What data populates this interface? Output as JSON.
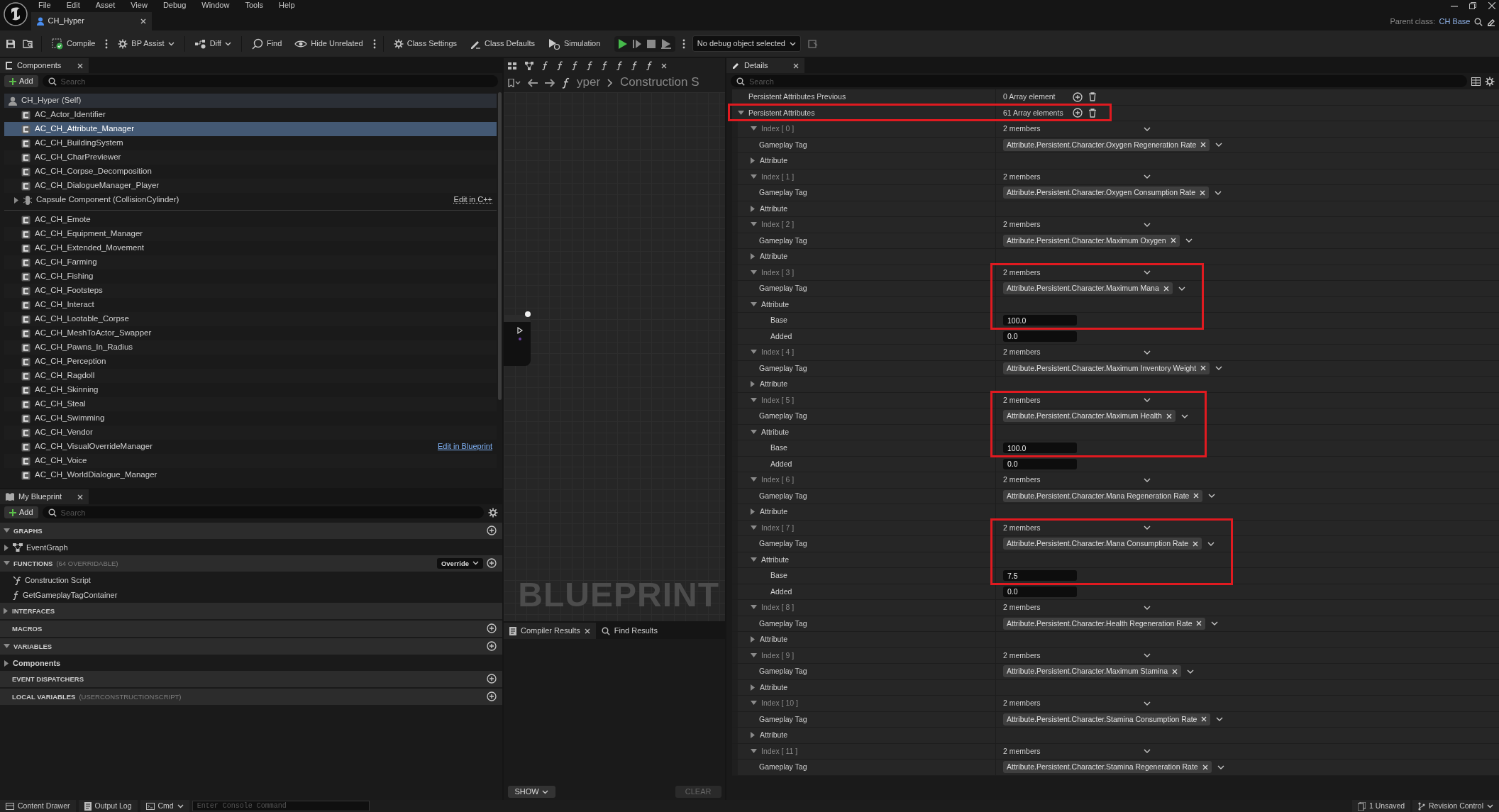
{
  "menu": [
    "File",
    "Edit",
    "Asset",
    "View",
    "Debug",
    "Window",
    "Tools",
    "Help"
  ],
  "document_tab": {
    "label": "CH_Hyper",
    "selected": true
  },
  "parent_class": {
    "label": "Parent class:",
    "value": "CH Base"
  },
  "toolbar": [
    {
      "label": "Compile",
      "more": true
    },
    {
      "label": "BP Assist",
      "dropdown": true
    },
    {
      "label": "Diff",
      "dropdown": true,
      "separator_before": true
    },
    {
      "label": "Find",
      "separator_before": true
    },
    {
      "label": "Hide Unrelated",
      "more": true
    },
    {
      "label": "Class Settings",
      "separator_before": true
    },
    {
      "label": "Class Defaults"
    },
    {
      "label": "Simulation"
    }
  ],
  "debug_object": "No debug object selected",
  "components": {
    "tab": "Components",
    "add_label": "Add",
    "search_placeholder": "Search",
    "root": "CH_Hyper (Self)",
    "items": [
      {
        "kind": "component",
        "label": "AC_Actor_Identifier",
        "selected": false
      },
      {
        "kind": "component",
        "label": "AC_CH_Attribute_Manager",
        "selected": true
      },
      {
        "kind": "component",
        "label": "AC_CH_BuildingSystem",
        "selected": false
      },
      {
        "kind": "component",
        "label": "AC_CH_CharPreviewer",
        "selected": false
      },
      {
        "kind": "component",
        "label": "AC_CH_Corpse_Decomposition",
        "selected": false
      },
      {
        "kind": "component",
        "label": "AC_CH_DialogueManager_Player",
        "selected": false
      },
      {
        "kind": "scene",
        "label": "Capsule Component (CollisionCylinder)",
        "selected": false,
        "expanded": false,
        "link": {
          "text": "Edit in C++",
          "kind": "cpp"
        }
      },
      {
        "kind": "divider"
      },
      {
        "kind": "component",
        "label": "AC_CH_Emote",
        "selected": false
      },
      {
        "kind": "component",
        "label": "AC_CH_Equipment_Manager",
        "selected": false
      },
      {
        "kind": "component",
        "label": "AC_CH_Extended_Movement",
        "selected": false
      },
      {
        "kind": "component",
        "label": "AC_CH_Farming",
        "selected": false
      },
      {
        "kind": "component",
        "label": "AC_CH_Fishing",
        "selected": false
      },
      {
        "kind": "component",
        "label": "AC_CH_Footsteps",
        "selected": false
      },
      {
        "kind": "component",
        "label": "AC_CH_Interact",
        "selected": false
      },
      {
        "kind": "component",
        "label": "AC_CH_Lootable_Corpse",
        "selected": false
      },
      {
        "kind": "component",
        "label": "AC_CH_MeshToActor_Swapper",
        "selected": false
      },
      {
        "kind": "component",
        "label": "AC_CH_Pawns_In_Radius",
        "selected": false
      },
      {
        "kind": "component",
        "label": "AC_CH_Perception",
        "selected": false
      },
      {
        "kind": "component",
        "label": "AC_CH_Ragdoll",
        "selected": false
      },
      {
        "kind": "component",
        "label": "AC_CH_Skinning",
        "selected": false
      },
      {
        "kind": "component",
        "label": "AC_CH_Steal",
        "selected": false
      },
      {
        "kind": "component",
        "label": "AC_CH_Swimming",
        "selected": false
      },
      {
        "kind": "component",
        "label": "AC_CH_Vendor",
        "selected": false
      },
      {
        "kind": "component",
        "label": "AC_CH_VisualOverrideManager",
        "selected": false,
        "link": {
          "text": "Edit in Blueprint",
          "kind": "blueprint"
        }
      },
      {
        "kind": "component",
        "label": "AC_CH_Voice",
        "selected": false
      },
      {
        "kind": "component",
        "label": "AC_CH_WorldDialogue_Manager",
        "selected": false
      }
    ]
  },
  "my_blueprint": {
    "tab": "My Blueprint",
    "add_label": "Add",
    "search_placeholder": "Search",
    "sections": [
      {
        "title": "GRAPHS",
        "expanded": true,
        "can_add": true,
        "items": [
          {
            "label": "EventGraph",
            "kind": "graph",
            "expanded": false
          }
        ]
      },
      {
        "title": "FUNCTIONS",
        "note": "(64 OVERRIDABLE)",
        "expanded": true,
        "override": "Override",
        "can_add": true,
        "items": [
          {
            "label": "Construction Script",
            "kind": "construction"
          },
          {
            "label": "GetGameplayTagContainer",
            "kind": "function"
          }
        ]
      },
      {
        "title": "INTERFACES",
        "expanded": false,
        "can_add": false
      },
      {
        "title": "MACROS",
        "can_add": true
      },
      {
        "title": "VARIABLES",
        "expanded": true,
        "can_add": true,
        "items": [
          {
            "label": "Components",
            "kind": "category",
            "expanded": false
          }
        ]
      },
      {
        "title": "EVENT DISPATCHERS",
        "can_add": true
      },
      {
        "title": "LOCAL VARIABLES",
        "note": "(USERCONSTRUCTIONSCRIPT)",
        "can_add": true
      }
    ]
  },
  "graph": {
    "breadcrumb": [
      "yper",
      "Construction S"
    ],
    "watermark": "BLUEPRINT"
  },
  "compiler": {
    "tabs": [
      {
        "label": "Compiler Results",
        "selected": true
      },
      {
        "label": "Find Results",
        "selected": false
      }
    ],
    "show": "SHOW",
    "clear": {
      "label": "CLEAR",
      "disabled": true
    }
  },
  "details": {
    "tab": "Details",
    "search_placeholder": "Search",
    "properties": [
      {
        "label": "Persistent Attributes Previous",
        "value": "0 Array element",
        "highlighted": false
      },
      {
        "label": "Persistent Attributes",
        "value": "61 Array elements",
        "expanded": true,
        "highlighted": true,
        "elements": [
          {
            "index": "Index [ 0 ]",
            "members": "2 members",
            "expanded": true,
            "tag_label": "Gameplay Tag",
            "tag": "Attribute.Persistent.Character.Oxygen Regeneration Rate",
            "attribute": {
              "label": "Attribute",
              "expanded": false
            },
            "highlighted": false
          },
          {
            "index": "Index [ 1 ]",
            "members": "2 members",
            "expanded": true,
            "tag_label": "Gameplay Tag",
            "tag": "Attribute.Persistent.Character.Oxygen Consumption Rate",
            "attribute": {
              "label": "Attribute",
              "expanded": false
            },
            "highlighted": false
          },
          {
            "index": "Index [ 2 ]",
            "members": "2 members",
            "expanded": true,
            "tag_label": "Gameplay Tag",
            "tag": "Attribute.Persistent.Character.Maximum Oxygen",
            "attribute": {
              "label": "Attribute",
              "expanded": false
            },
            "highlighted": false
          },
          {
            "index": "Index [ 3 ]",
            "members": "2 members",
            "expanded": true,
            "tag_label": "Gameplay Tag",
            "tag": "Attribute.Persistent.Character.Maximum Mana",
            "attribute": {
              "label": "Attribute",
              "expanded": true,
              "fields": [
                {
                  "label": "Base",
                  "value": "100.0"
                },
                {
                  "label": "Added",
                  "value": "0.0"
                }
              ]
            },
            "highlighted": true
          },
          {
            "index": "Index [ 4 ]",
            "members": "2 members",
            "expanded": true,
            "tag_label": "Gameplay Tag",
            "tag": "Attribute.Persistent.Character.Maximum Inventory Weight",
            "attribute": {
              "label": "Attribute",
              "expanded": false
            },
            "highlighted": false
          },
          {
            "index": "Index [ 5 ]",
            "members": "2 members",
            "expanded": true,
            "tag_label": "Gameplay Tag",
            "tag": "Attribute.Persistent.Character.Maximum Health",
            "attribute": {
              "label": "Attribute",
              "expanded": true,
              "fields": [
                {
                  "label": "Base",
                  "value": "100.0"
                },
                {
                  "label": "Added",
                  "value": "0.0"
                }
              ]
            },
            "highlighted": true
          },
          {
            "index": "Index [ 6 ]",
            "members": "2 members",
            "expanded": true,
            "tag_label": "Gameplay Tag",
            "tag": "Attribute.Persistent.Character.Mana Regeneration Rate",
            "attribute": {
              "label": "Attribute",
              "expanded": false
            },
            "highlighted": false
          },
          {
            "index": "Index [ 7 ]",
            "members": "2 members",
            "expanded": true,
            "tag_label": "Gameplay Tag",
            "tag": "Attribute.Persistent.Character.Mana Consumption Rate",
            "attribute": {
              "label": "Attribute",
              "expanded": true,
              "fields": [
                {
                  "label": "Base",
                  "value": "7.5"
                },
                {
                  "label": "Added",
                  "value": "0.0"
                }
              ]
            },
            "highlighted": true
          },
          {
            "index": "Index [ 8 ]",
            "members": "2 members",
            "expanded": true,
            "tag_label": "Gameplay Tag",
            "tag": "Attribute.Persistent.Character.Health Regeneration Rate",
            "attribute": {
              "label": "Attribute",
              "expanded": false
            },
            "highlighted": false
          },
          {
            "index": "Index [ 9 ]",
            "members": "2 members",
            "expanded": true,
            "tag_label": "Gameplay Tag",
            "tag": "Attribute.Persistent.Character.Maximum Stamina",
            "attribute": {
              "label": "Attribute",
              "expanded": false
            },
            "highlighted": false
          },
          {
            "index": "Index [ 10 ]",
            "members": "2 members",
            "expanded": true,
            "tag_label": "Gameplay Tag",
            "tag": "Attribute.Persistent.Character.Stamina Consumption Rate",
            "attribute": {
              "label": "Attribute",
              "expanded": false
            },
            "highlighted": false
          },
          {
            "index": "Index [ 11 ]",
            "members": "2 members",
            "expanded": true,
            "tag_label": "Gameplay Tag",
            "tag": "Attribute.Persistent.Character.Stamina Regeneration Rate",
            "highlighted": false
          }
        ]
      }
    ]
  },
  "status_bar": {
    "content_drawer": "Content Drawer",
    "output_log": "Output Log",
    "cmd": "Cmd",
    "console_placeholder": "Enter Console Command",
    "unsaved": "1 Unsaved",
    "revision_control": "Revision Control"
  }
}
